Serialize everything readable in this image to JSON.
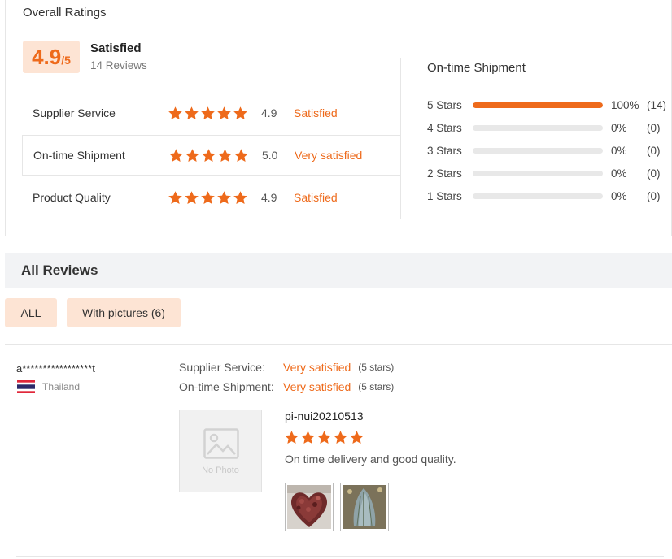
{
  "overall": {
    "title": "Overall Ratings",
    "score": "4.9",
    "score_denom": "/5",
    "label": "Satisfied",
    "review_count": "14 Reviews"
  },
  "categories": [
    {
      "name": "Supplier Service",
      "stars": 5,
      "score": "4.9",
      "text": "Satisfied"
    },
    {
      "name": "On-time Shipment",
      "stars": 5,
      "score": "5.0",
      "text": "Very satisfied"
    },
    {
      "name": "Product Quality",
      "stars": 5,
      "score": "4.9",
      "text": "Satisfied"
    }
  ],
  "distribution": {
    "title": "On-time Shipment",
    "rows": [
      {
        "label": "5  Stars",
        "fraction": 1.0,
        "pct": "100%",
        "count": "(14)"
      },
      {
        "label": "4  Stars",
        "fraction": 0,
        "pct": "0%",
        "count": "(0)"
      },
      {
        "label": "3  Stars",
        "fraction": 0,
        "pct": "0%",
        "count": "(0)"
      },
      {
        "label": "2  Stars",
        "fraction": 0,
        "pct": "0%",
        "count": "(0)"
      },
      {
        "label": "1  Stars",
        "fraction": 0,
        "pct": "0%",
        "count": "(0)"
      }
    ]
  },
  "reviews_section": {
    "title": "All Reviews",
    "filters": [
      "ALL",
      "With pictures (6)"
    ]
  },
  "review": {
    "reviewer": "a*****************t",
    "country": "Thailand",
    "rows": [
      {
        "label": "Supplier Service:",
        "value": "Very satisfied",
        "stars": "(5 stars)"
      },
      {
        "label": "On-time Shipment:",
        "value": "Very satisfied",
        "stars": "(5 stars)"
      }
    ],
    "no_photo": "No Photo",
    "product": "pi-nui20210513",
    "rating": 5,
    "text": "On time delivery and good quality."
  },
  "colors": {
    "accent": "#ee6a1b",
    "accent_light": "#fde4d4",
    "header_bg": "#f2f3f5"
  },
  "icons": {
    "star": "star-icon",
    "flag": "thailand-flag-icon",
    "no_photo": "image-placeholder-icon"
  }
}
